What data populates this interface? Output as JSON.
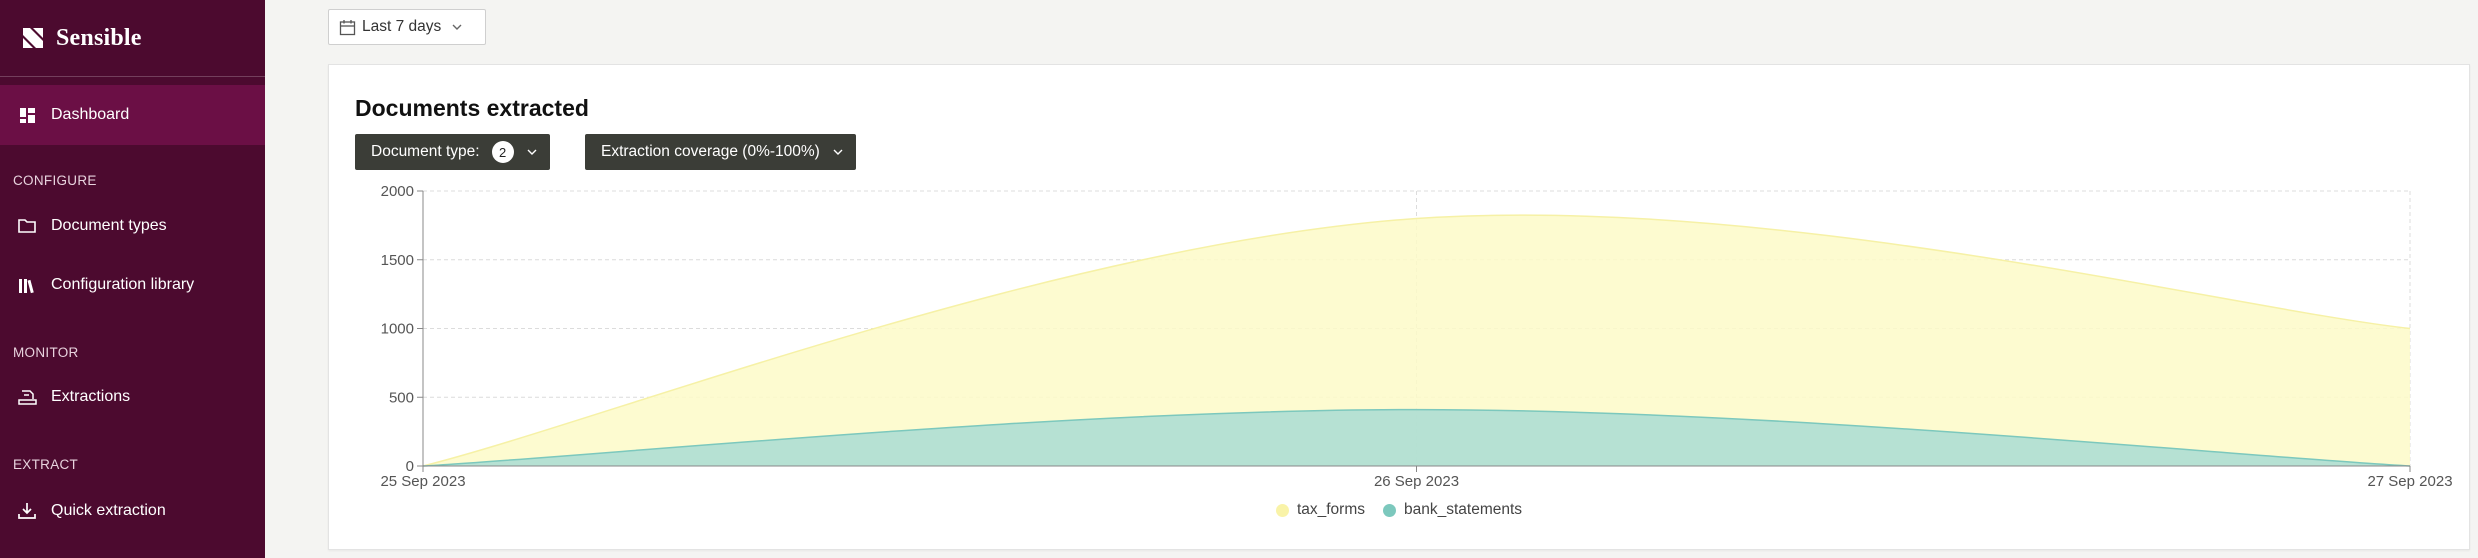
{
  "brand": {
    "name": "Sensible"
  },
  "sidebar": {
    "dashboard": "Dashboard",
    "sections": {
      "configure": "CONFIGURE",
      "monitor": "MONITOR",
      "extract": "EXTRACT"
    },
    "items": {
      "document_types": "Document types",
      "configuration_library": "Configuration library",
      "extractions": "Extractions",
      "quick_extraction": "Quick extraction"
    }
  },
  "date_filter": {
    "label": "Last 7 days"
  },
  "card": {
    "title": "Documents extracted",
    "document_type_filter": {
      "label": "Document type:",
      "count": "2"
    },
    "coverage_filter": {
      "label": "Extraction coverage (0%-100%)"
    }
  },
  "colors": {
    "sidebar_bg": "#4c0a2f",
    "sidebar_active": "#6b0f45",
    "tax_forms": "#fdfac8",
    "bank_statements": "#a9dcd4",
    "filter_btn": "#3b3d37"
  },
  "chart_data": {
    "type": "area",
    "x": [
      "25 Sep 2023",
      "26 Sep 2023",
      "27 Sep 2023"
    ],
    "y_ticks": [
      "0",
      "500",
      "1000",
      "1500",
      "2000"
    ],
    "ylim": [
      0,
      2000
    ],
    "grid": true,
    "legend_position": "bottom-center",
    "series": [
      {
        "name": "tax_forms",
        "values": [
          0,
          1800,
          1000
        ],
        "color": "#fdfac8",
        "stroke": "#f6f1a6"
      },
      {
        "name": "bank_statements",
        "values": [
          0,
          410,
          0
        ],
        "color": "#a9dcd4",
        "stroke": "#7cc8bd"
      }
    ]
  }
}
